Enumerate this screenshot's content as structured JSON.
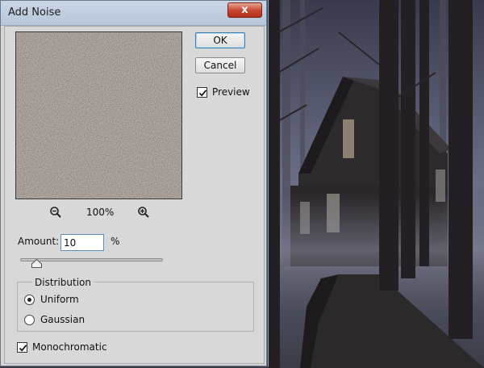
{
  "dialog": {
    "title": "Add Noise",
    "close_symbol": "x",
    "ok_label": "OK",
    "cancel_label": "Cancel",
    "preview_label": "Preview",
    "preview_checked": true,
    "zoom_out_icon": "zoom-out-icon",
    "zoom_in_icon": "zoom-in-icon",
    "zoom_level": "100%",
    "amount_label": "Amount:",
    "amount_value": "10",
    "amount_unit": "%",
    "amount_slider_level": 0.1,
    "distribution_title": "Distribution",
    "distribution_options": [
      "Uniform",
      "Gaussian"
    ],
    "distribution_selected": "Uniform",
    "monochromatic_label": "Monochromatic",
    "monochromatic_checked": true
  },
  "colors": {
    "titlebar": "#c3d1e3",
    "close_button": "#c7432c",
    "dialog_bg": "#d8d8d8",
    "noise_base": "#7d726b"
  }
}
